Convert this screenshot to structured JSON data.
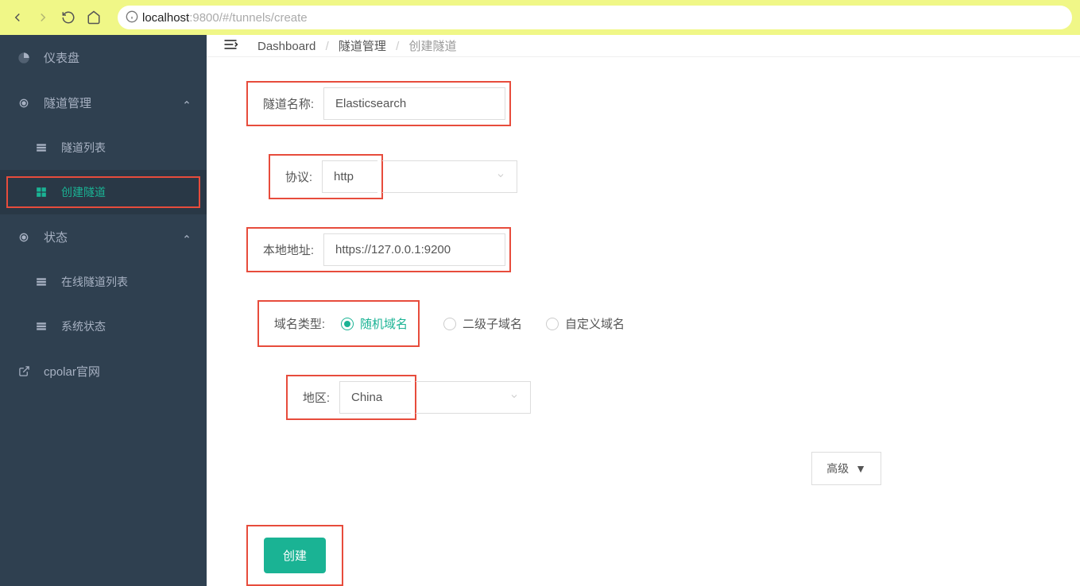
{
  "browser": {
    "url_prefix": "localhost",
    "url_path": ":9800/#/tunnels/create"
  },
  "sidebar": {
    "items": [
      {
        "label": "仪表盘",
        "icon": "dashboard"
      },
      {
        "label": "隧道管理",
        "icon": "cog",
        "expandable": true,
        "children": [
          {
            "label": "隧道列表",
            "icon": "table"
          },
          {
            "label": "创建隧道",
            "icon": "grid",
            "active": true
          }
        ]
      },
      {
        "label": "状态",
        "icon": "cog",
        "expandable": true,
        "children": [
          {
            "label": "在线隧道列表",
            "icon": "table"
          },
          {
            "label": "系统状态",
            "icon": "table"
          }
        ]
      },
      {
        "label": "cpolar官网",
        "icon": "external"
      }
    ]
  },
  "breadcrumb": {
    "items": [
      "Dashboard",
      "隧道管理",
      "创建隧道"
    ]
  },
  "form": {
    "tunnel_name": {
      "label": "隧道名称:",
      "value": "Elasticsearch"
    },
    "protocol": {
      "label": "协议:",
      "value": "http"
    },
    "local_addr": {
      "label": "本地地址:",
      "value": "https://127.0.0.1:9200"
    },
    "domain_type": {
      "label": "域名类型:",
      "options": [
        "随机域名",
        "二级子域名",
        "自定义域名"
      ],
      "selected": 0
    },
    "region": {
      "label": "地区:",
      "value": "China"
    },
    "advanced": "高级",
    "submit": "创建"
  }
}
